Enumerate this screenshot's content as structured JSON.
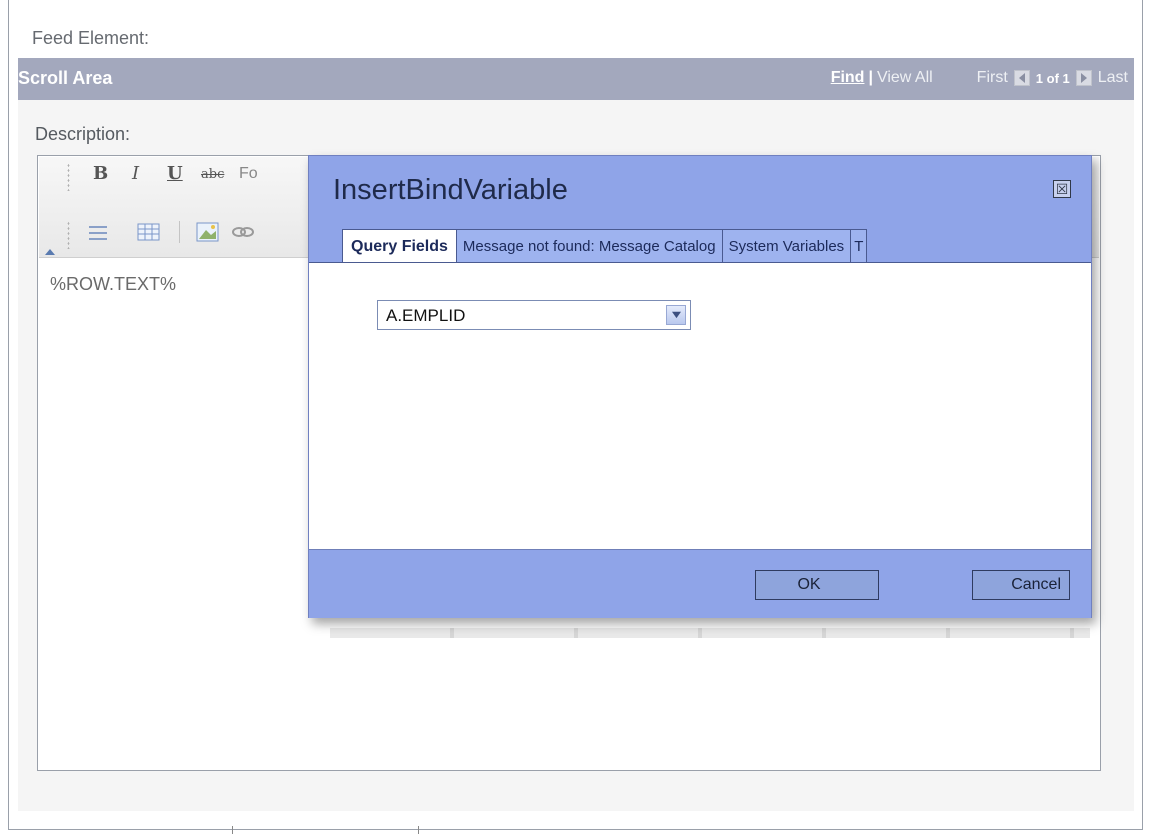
{
  "page": {
    "section_label": "Feed Element:"
  },
  "scroll_area": {
    "title": "Scroll Area",
    "find": "Find",
    "separator": "|",
    "view_all": "View All",
    "first": "First",
    "count": "1 of 1",
    "last": "Last"
  },
  "editor": {
    "label": "Description:",
    "toolbar_row1": [
      "B",
      "I",
      "U",
      "abc",
      "Fo"
    ],
    "content": "%ROW.TEXT%"
  },
  "dialog": {
    "title": "InsertBindVariable",
    "close_glyph": "☒",
    "tabs": [
      {
        "label": "Query Fields",
        "active": true
      },
      {
        "label": "Message not found: Message Catalog",
        "active": false
      },
      {
        "label": "System Variables",
        "active": false
      },
      {
        "label": "T",
        "active": false
      }
    ],
    "field_select": {
      "value": "A.EMPLID"
    },
    "ok_label": "OK",
    "cancel_label": "Cancel"
  },
  "colors": {
    "scroll_header": "#a3a8bd",
    "dialog_bg": "#8fa4e8",
    "tab_inactive": "#9eb3ef"
  }
}
